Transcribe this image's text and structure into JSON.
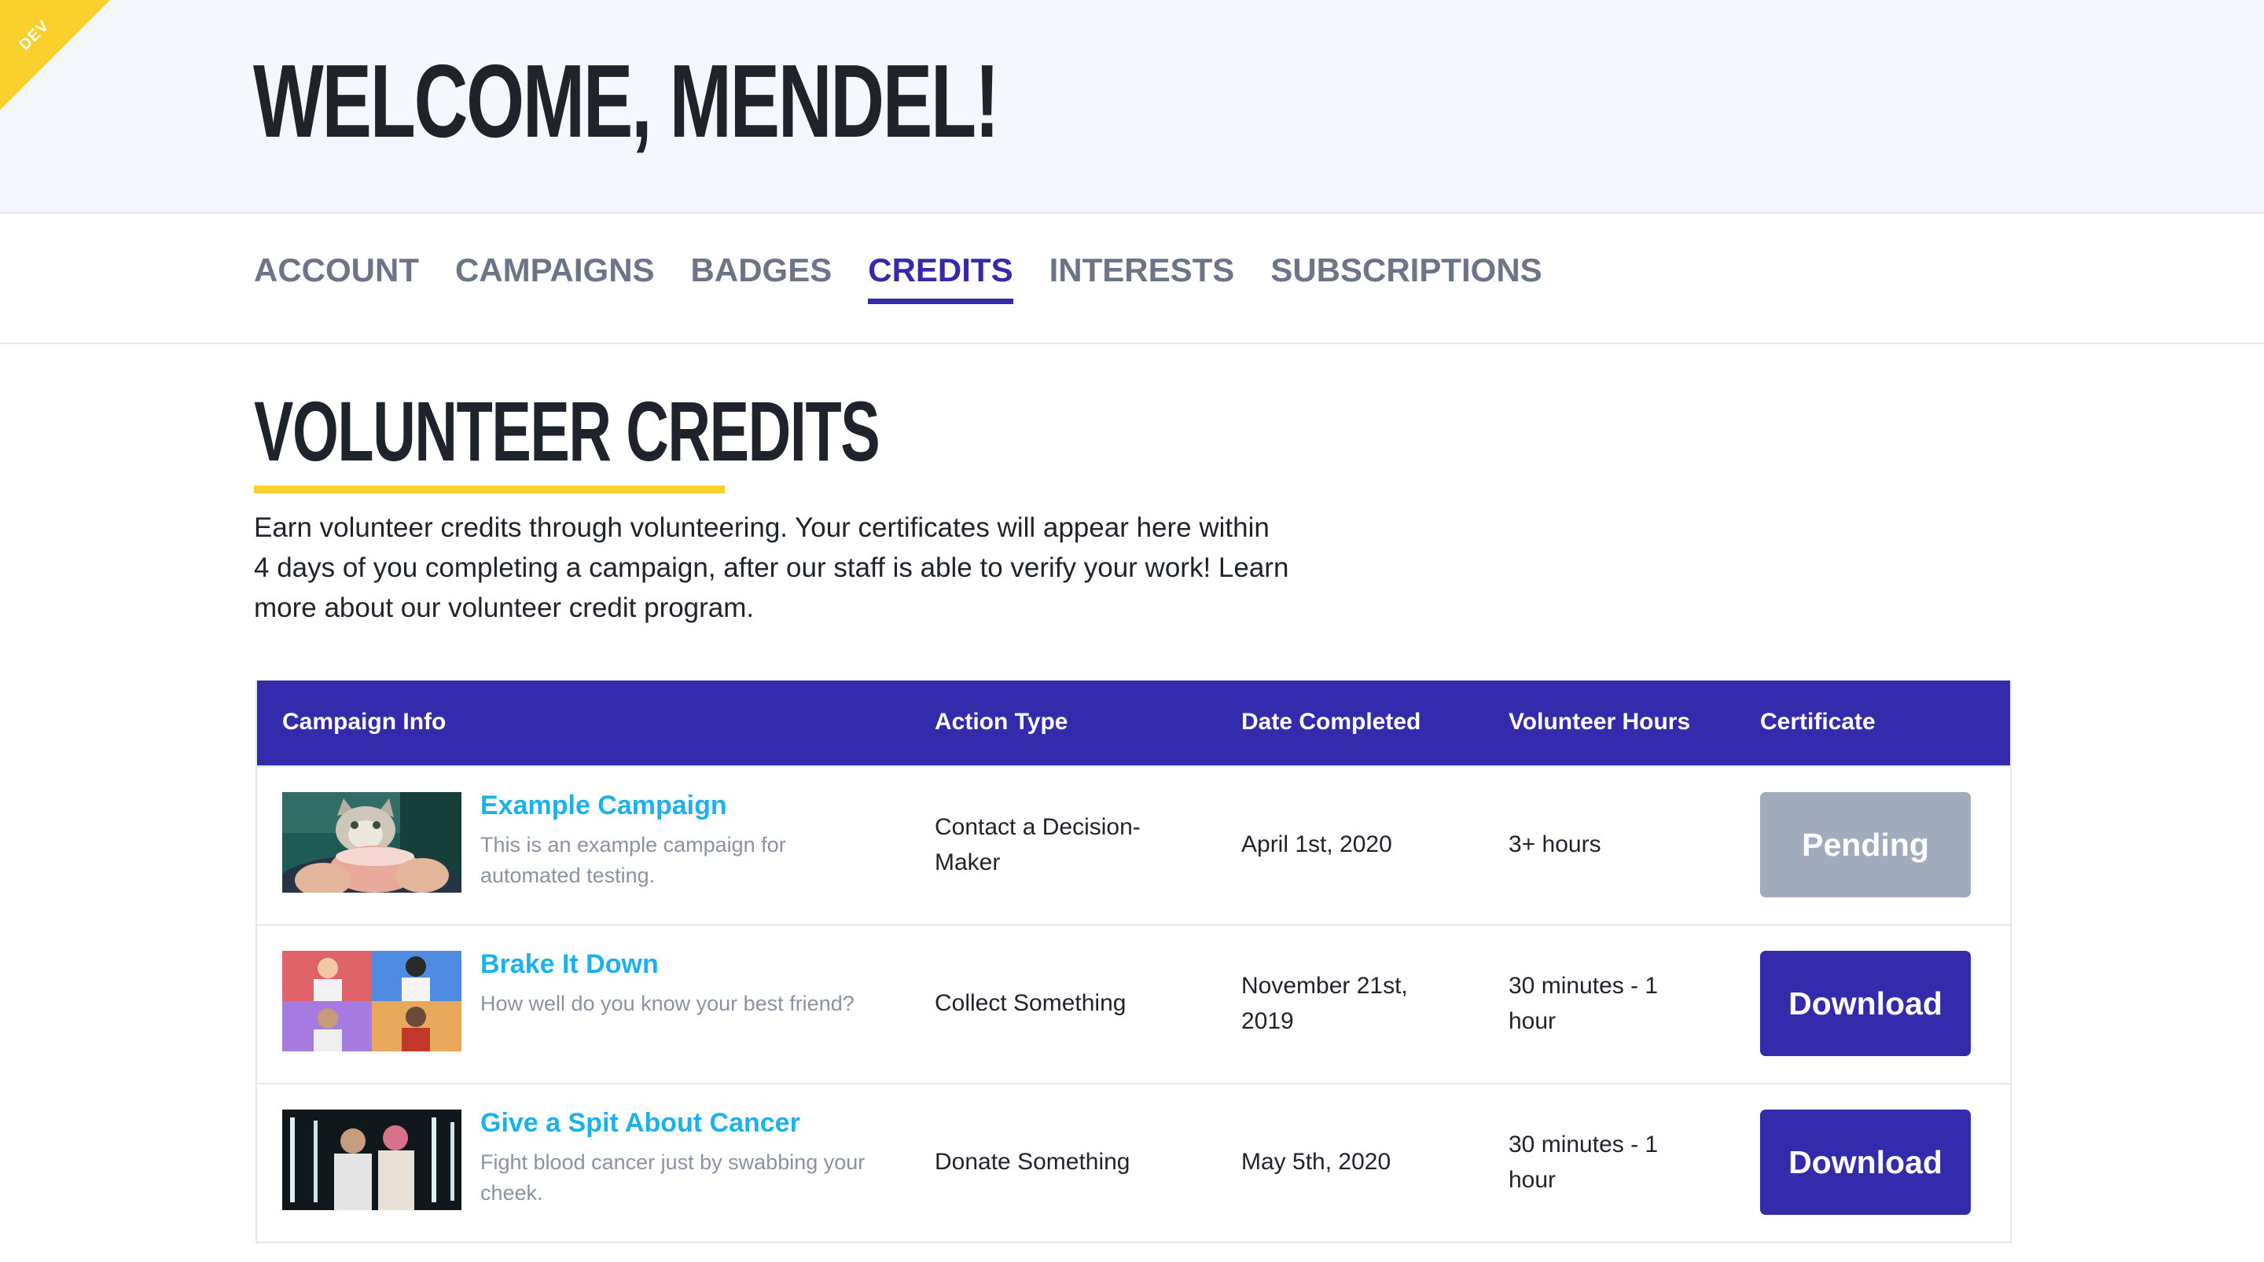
{
  "env_badge": "DEV",
  "header": {
    "title": "WELCOME, MENDEL!"
  },
  "tabs": [
    {
      "label": "ACCOUNT",
      "active": false
    },
    {
      "label": "CAMPAIGNS",
      "active": false
    },
    {
      "label": "BADGES",
      "active": false
    },
    {
      "label": "CREDITS",
      "active": true
    },
    {
      "label": "INTERESTS",
      "active": false
    },
    {
      "label": "SUBSCRIPTIONS",
      "active": false
    }
  ],
  "section": {
    "title": "VOLUNTEER CREDITS",
    "intro": "Earn volunteer credits through volunteering. Your certificates will appear here within 4 days of you completing a campaign, after our staff is able to verify your work! Learn more about our volunteer credit program."
  },
  "table": {
    "columns": [
      "Campaign Info",
      "Action Type",
      "Date Completed",
      "Volunteer Hours",
      "Certificate"
    ],
    "rows": [
      {
        "title": "Example Campaign",
        "description": "This is an example campaign for automated testing.",
        "action_type": "Contact a Decision-Maker",
        "date_completed": "April 1st, 2020",
        "volunteer_hours": "3+ hours",
        "certificate": "Pending",
        "thumbnail": "cat-with-coffee-cup-image"
      },
      {
        "title": "Brake It Down",
        "description": "How well do you know your best friend?",
        "action_type": "Collect Something",
        "date_completed": "November 21st, 2019",
        "volunteer_hours": "30 minutes - 1 hour",
        "certificate": "Download",
        "thumbnail": "four-panel-colorful-portraits-image"
      },
      {
        "title": "Give a Spit About Cancer",
        "description": "Fight blood cancer just by swabbing your cheek.",
        "action_type": "Donate Something",
        "date_completed": "May 5th, 2020",
        "volunteer_hours": "30 minutes - 1 hour",
        "certificate": "Download",
        "thumbnail": "two-people-dark-stage-image"
      }
    ]
  },
  "colors": {
    "primary": "#332bab",
    "link": "#1ab1ec",
    "accent": "#fbcf2c",
    "pending": "#a0acbe",
    "header_bg": "#f4f8fc"
  }
}
